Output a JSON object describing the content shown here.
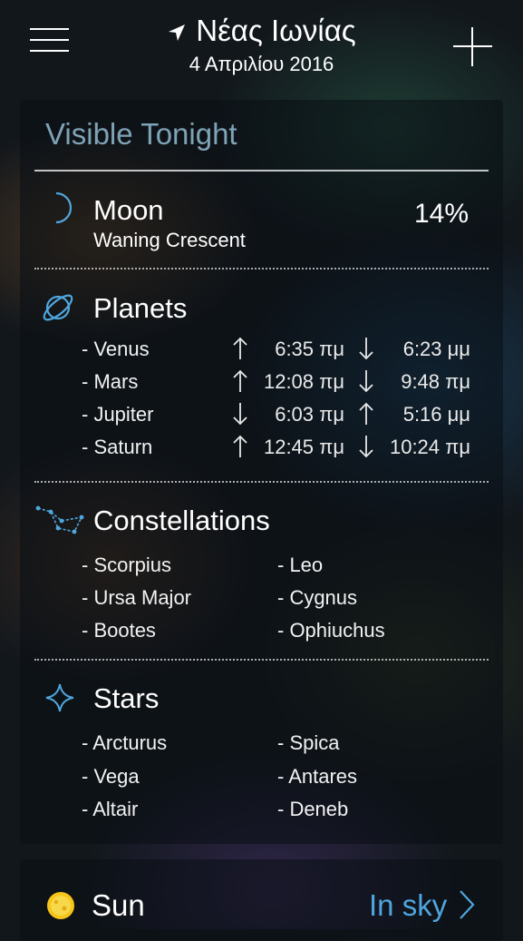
{
  "header": {
    "location": "Νέας Ιωνίας",
    "date": "4 Απριλίου 2016"
  },
  "visible": {
    "title": "Visible Tonight",
    "moon": {
      "label": "Moon",
      "phase": "Waning Crescent",
      "illumination": "14%"
    },
    "planets": {
      "label": "Planets",
      "items": [
        {
          "name": "- Venus",
          "first_icon": "arrow-up-icon",
          "first_time": "6:35 πμ",
          "second_icon": "arrow-down-icon",
          "second_time": "6:23 μμ"
        },
        {
          "name": "- Mars",
          "first_icon": "arrow-up-icon",
          "first_time": "12:08 πμ",
          "second_icon": "arrow-down-icon",
          "second_time": "9:48 πμ"
        },
        {
          "name": "- Jupiter",
          "first_icon": "arrow-down-icon",
          "first_time": "6:03 πμ",
          "second_icon": "arrow-up-icon",
          "second_time": "5:16 μμ"
        },
        {
          "name": "- Saturn",
          "first_icon": "arrow-up-icon",
          "first_time": "12:45 πμ",
          "second_icon": "arrow-down-icon",
          "second_time": "10:24 πμ"
        }
      ]
    },
    "constellations": {
      "label": "Constellations",
      "left": [
        "- Scorpius",
        "- Ursa Major",
        "- Bootes"
      ],
      "right": [
        "- Leo",
        "- Cygnus",
        "- Ophiuchus"
      ]
    },
    "stars": {
      "label": "Stars",
      "left": [
        "- Arcturus",
        "- Vega",
        "- Altair"
      ],
      "right": [
        "- Spica",
        "- Antares",
        "- Deneb"
      ]
    }
  },
  "sun": {
    "label": "Sun",
    "status": "In sky"
  },
  "colors": {
    "accent": "#4fa6dd",
    "section_title": "#7fa3b6",
    "sun": "#f5c518"
  }
}
